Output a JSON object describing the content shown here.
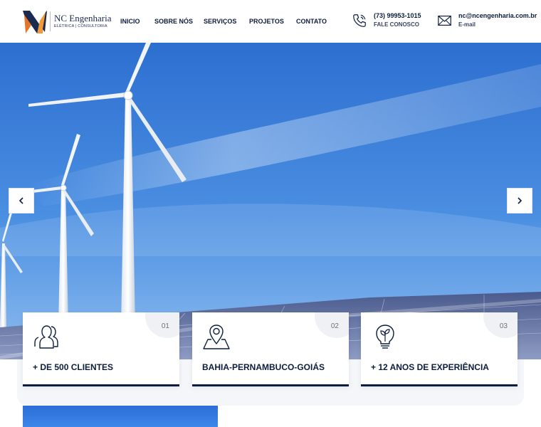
{
  "brand": {
    "name": "NC Engenharia",
    "tagline": "ELÉTRICA | CONSULTORIA"
  },
  "nav": {
    "items": [
      "INICIO",
      "SOBRE NÓS",
      "SERVIÇOS",
      "PROJETOS",
      "CONTATO"
    ]
  },
  "contact": {
    "phone": "(73) 99953-1015",
    "phone_label": "FALE CONOSCO",
    "email": "nc@ncengenharia.com.br",
    "email_label": "E-mail"
  },
  "hero": {
    "prev_icon": "chevron-left-icon",
    "next_icon": "chevron-right-icon"
  },
  "features": [
    {
      "number": "01",
      "title": "+ DE 500 CLIENTES",
      "icon": "users-icon"
    },
    {
      "number": "02",
      "title": "BAHIA-PERNAMBUCO-GOIÁS",
      "icon": "map-pin-icon"
    },
    {
      "number": "03",
      "title": "+ 12 ANOS DE EXPERIÊNCIA",
      "icon": "lightbulb-leaf-icon"
    }
  ],
  "colors": {
    "navy": "#0c1d3d",
    "sky": "#4a8fe0",
    "logo_orange": "#e8742a"
  }
}
